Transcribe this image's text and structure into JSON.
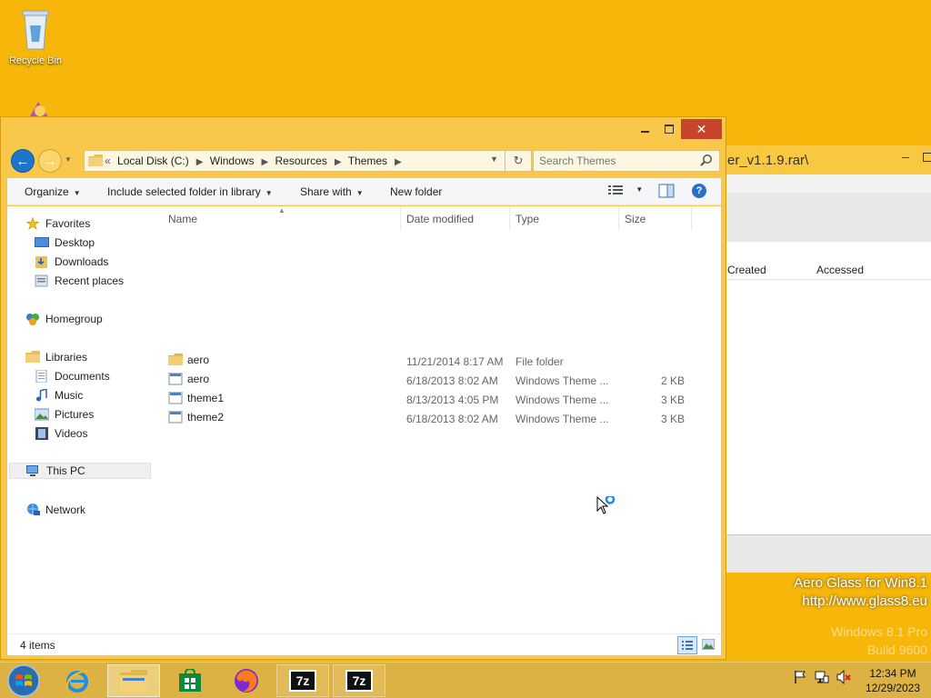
{
  "desktop": {
    "recycle_bin_label": "Recycle Bin",
    "watermark": {
      "line1": "Aero Glass for Win8.1",
      "line2": "http://www.glass8.eu",
      "line3": "Windows 8.1 Pro",
      "line4": "Build 9600"
    }
  },
  "background_window": {
    "title_fragment": "er_v1.1.9.rar\\",
    "columns": [
      "Created",
      "Accessed"
    ]
  },
  "explorer": {
    "title_buttons": {
      "close": "✕"
    },
    "address": {
      "overflow": "«",
      "crumbs": [
        "Local Disk (C:)",
        "Windows",
        "Resources",
        "Themes"
      ]
    },
    "search": {
      "placeholder": "Search Themes"
    },
    "commands": {
      "organize": "Organize",
      "include": "Include selected folder in library",
      "share": "Share with",
      "new_folder": "New folder"
    },
    "nav": {
      "favorites": "Favorites",
      "desktop": "Desktop",
      "downloads": "Downloads",
      "recent": "Recent places",
      "homegroup": "Homegroup",
      "libraries": "Libraries",
      "documents": "Documents",
      "music": "Music",
      "pictures": "Pictures",
      "videos": "Videos",
      "this_pc": "This PC",
      "network": "Network"
    },
    "columns": {
      "name": "Name",
      "date": "Date modified",
      "type": "Type",
      "size": "Size"
    },
    "files": [
      {
        "name": "aero",
        "date": "11/21/2014 8:17 AM",
        "type": "File folder",
        "size": "",
        "icon": "folder-icon"
      },
      {
        "name": "aero",
        "date": "6/18/2013 8:02 AM",
        "type": "Windows Theme ...",
        "size": "2 KB",
        "icon": "theme-file-icon"
      },
      {
        "name": "theme1",
        "date": "8/13/2013 4:05 PM",
        "type": "Windows Theme ...",
        "size": "3 KB",
        "icon": "theme-file-icon"
      },
      {
        "name": "theme2",
        "date": "6/18/2013 8:02 AM",
        "type": "Windows Theme ...",
        "size": "3 KB",
        "icon": "theme-file-icon"
      }
    ],
    "status": {
      "item_count": "4 items"
    }
  },
  "taskbar": {
    "clock": {
      "time": "12:34 PM",
      "date": "12/29/2023"
    },
    "sevenzip_label": "7z"
  }
}
